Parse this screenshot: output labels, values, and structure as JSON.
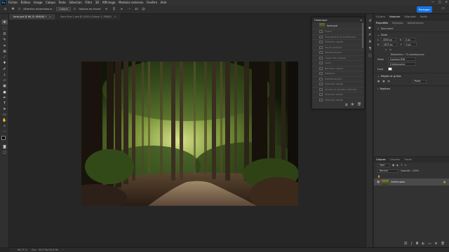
{
  "menu": {
    "items": [
      "Fichier",
      "Édition",
      "Image",
      "Calque",
      "Texte",
      "Sélection",
      "Filtre",
      "3D",
      "Affichage",
      "Modules externes",
      "Fenêtre",
      "Aide"
    ],
    "window_controls": [
      "—",
      "▢",
      "✕"
    ]
  },
  "options_bar": {
    "auto_select": "Sélection automatique :",
    "auto_select_value": "Calque",
    "transform_controls": "Options de transf.",
    "share": "Partager",
    "more": "3D"
  },
  "tabs": [
    {
      "label": "foret.psd @ 66,15 (RVB/8) *",
      "active": true
    },
    {
      "label": "Sans titre-1 psd @ 100% (Calque 1, RVB/8)",
      "active": false
    }
  ],
  "tools": [
    "move-icon",
    "marquee-icon",
    "lasso-icon",
    "crop-icon",
    "eyedropper-icon",
    "heal-icon",
    "brush-icon",
    "stamp-icon",
    "history-brush-icon",
    "eraser-icon",
    "gradient-icon",
    "blur-icon",
    "dodge-icon",
    "pen-icon",
    "type-icon",
    "path-select-icon",
    "shape-icon",
    "hand-icon",
    "zoom-icon"
  ],
  "history": {
    "title": "Historique",
    "snapshot": "foret.psd",
    "items": [
      "Ouvrir",
      "Chargement de la sélection",
      "Sélection rapide",
      "Pot de peinture",
      "Désélectionner",
      "Copier des calques",
      "Coller",
      "Nouveau calque",
      "Déplacer",
      "Désélectionner",
      "Sélection rapide",
      "Annuler la dernière sélection",
      "Sélection rapide",
      "Sélection rapide"
    ]
  },
  "right_panel": {
    "tabs": [
      "Couleur",
      "Nuancier",
      "Dégradés",
      "Motifs"
    ],
    "prop_tabs": [
      "Propriétés",
      "Réglages",
      "Bibliothèques"
    ],
    "doc_label": "Document",
    "canvas_section": "Zone",
    "w_label": "L",
    "w_value": "4000 px",
    "h_label": "H",
    "h_value": "2670 px",
    "x_value": "0 px",
    "y_value": "0 px",
    "resolution": "Résolution : 72 pixels/pouce",
    "mode_label": "Mode",
    "mode_value": "Couleurs RVB",
    "depth_value": "8 bits/couche",
    "fill_label": "Fond",
    "rulers_section": "Règles et grilles",
    "pixels_value": "Pixels",
    "guides_section": "Repères",
    "layers_tabs": [
      "Calques",
      "Couches",
      "Tracés"
    ],
    "layer_kind": "Type",
    "blend_mode": "Normal",
    "opacity": "Opacité : 100%",
    "layer_name": "Arrière-plan"
  },
  "status": {
    "zoom": "66,15 %",
    "doc_size": "Doc : 30,6 Mo/30,6 Mo"
  }
}
